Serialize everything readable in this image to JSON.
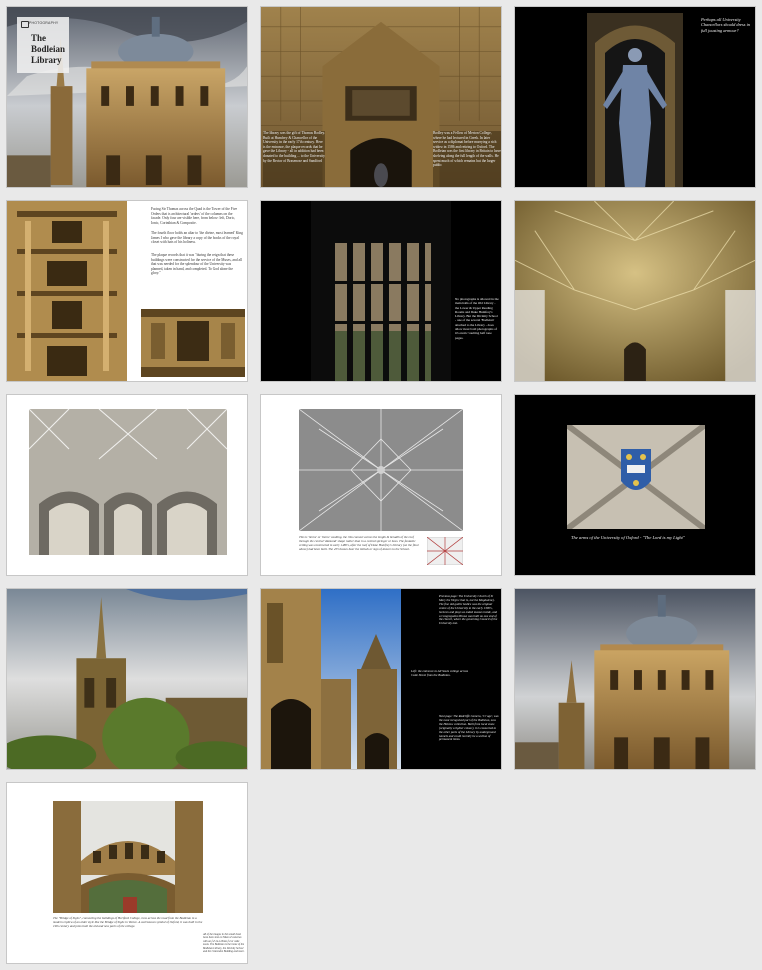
{
  "title_block": {
    "brand": "PHOTOGRAPHY",
    "title": "The Bodleian Library"
  },
  "page_humfrey_entrance": {
    "left_text": "The library was the gift of Thomas Bodley. Built at Humfrey & Chancellor of the University in the early 17th century. Here is the entrance, the plaque records that he gave the Library - all in addition had been donated to the building ... to the University by the Rector of Brasenose and Sandford",
    "right_text": "Bodley was a Fellow of Merton College, where he had lectured in Greek. In later service as a diplomat before marrying a rich widow in 1586 and retiring to Oxford. The Bodleian was the first library in Britain to have shelving along the full length of the walls. He spent much of which remains but the larger public"
  },
  "page_statue": {
    "caption": "Perhaps all University Chancellors should dress in full jousting armour?"
  },
  "page_tower": {
    "para1": "Facing Sir Thomas across the Quad is the Tower of the Five Orders that is architectural 'orders' of the columns on the facade. Only four are visible here, from below: left, Doric, Ionic, Corinthian & Composite.",
    "para2": "The fourth floor holds an altar to 'the divine, most learned' King James I who gave the library a copy of the books of the royal closet with hats of his holiness.",
    "para3": "The plaque records that it was \"during the reign that these buildings were constructed for the service of the Muses, and all that was needed for the splendour of the University was planned, taken in hand, and completed. To God alone the glory.\""
  },
  "page_window": {
    "caption": "No photographs is allowed in the main halls of the Old Library - the Lower & Upper Reading Rooms and Duke Humfrey's Library. But the Divinity School - one of the several 'Bodleian' attached to the Library - does allow most bold photographs of it's exotic vaulting half tone pages."
  },
  "page_vault_detail": {
    "caption": "This is 'lierne' or 'tierne' vaulting, the ribs connect across the length & breadth of the roof through the central 'diamond' shape rather than in a central springer or boss. The fantastic ceiling was constructed in early 1480's, after the roof of Duke Humfrey's Library (on the floor above) had been built. The 455 bosses bear the initials or sign of donors to the School."
  },
  "page_arms": {
    "caption": "The arms of the University of Oxford - \"The Lord is my Light\""
  },
  "page_radcliffe_night": {
    "text_top": "Previous page: The University Church of St Mary the Virgin: that is, not the Magdalene). The fine old gothic bodice was the original centre of the University in the early 1300's, lectures and plays as ended masses inside, and a Congregation House was built on one end of the church, where the governing Council of the University met.",
    "text_middle": "Left: the entrance to All Souls college across Catte Street from the Bodleian.",
    "text_bottom": "Next page: The Radcliffe Camera, 'Cr`age', was the most recognised part of the Bodleian, now the Hebrew collection. Built from local stone (originally a lighter colour), it is connected to the other parts of the Library by underground tunnels and could recently be a section of permanent items."
  },
  "page_bridge": {
    "caption": "The \"Bridge of Sighs\", connecting the buildings of Hertford College, runs across the road from the Bodleian in a modern replica of an older style like the Bridge of Sighs in Venice. A well-known symbol of Oxford, it was built in the 19th century and joins both the old and new parts of the college.",
    "side_note": "All of the images in this small book have been shot on Nikon Z cameras with an f-Z 24-120mm f/4 or wide zoom. The Bodleian is the home of the Bodleian Library, the Divinity School and the Clarendon Building and more."
  }
}
